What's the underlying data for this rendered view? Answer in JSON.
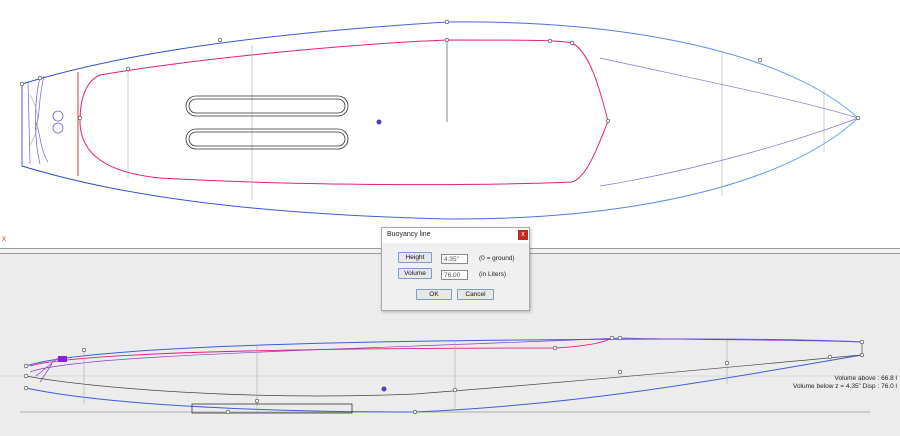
{
  "top_view": {
    "axis_marker": "x"
  },
  "dialog": {
    "title": "Buoyancy line",
    "close_label": "x",
    "height": {
      "button_label": "Height",
      "value": "4.35\"",
      "hint": "(0 = ground)"
    },
    "volume": {
      "button_label": "Volume",
      "value": "76.00",
      "hint": "(in Liters)"
    },
    "ok_label": "OK",
    "cancel_label": "Cancel"
  },
  "status": {
    "volume_above": "Volume above : 66.8 l",
    "volume_below": "Volume below z = 4.35\" Disp : 76.0 l"
  },
  "colors": {
    "outline_blue": "#3a5fd8",
    "deck_magenta": "#e0207a",
    "rocker_purple": "#8a3cc8",
    "center_dot": "#4a3fc8",
    "dialog_close": "#c42b1c"
  }
}
